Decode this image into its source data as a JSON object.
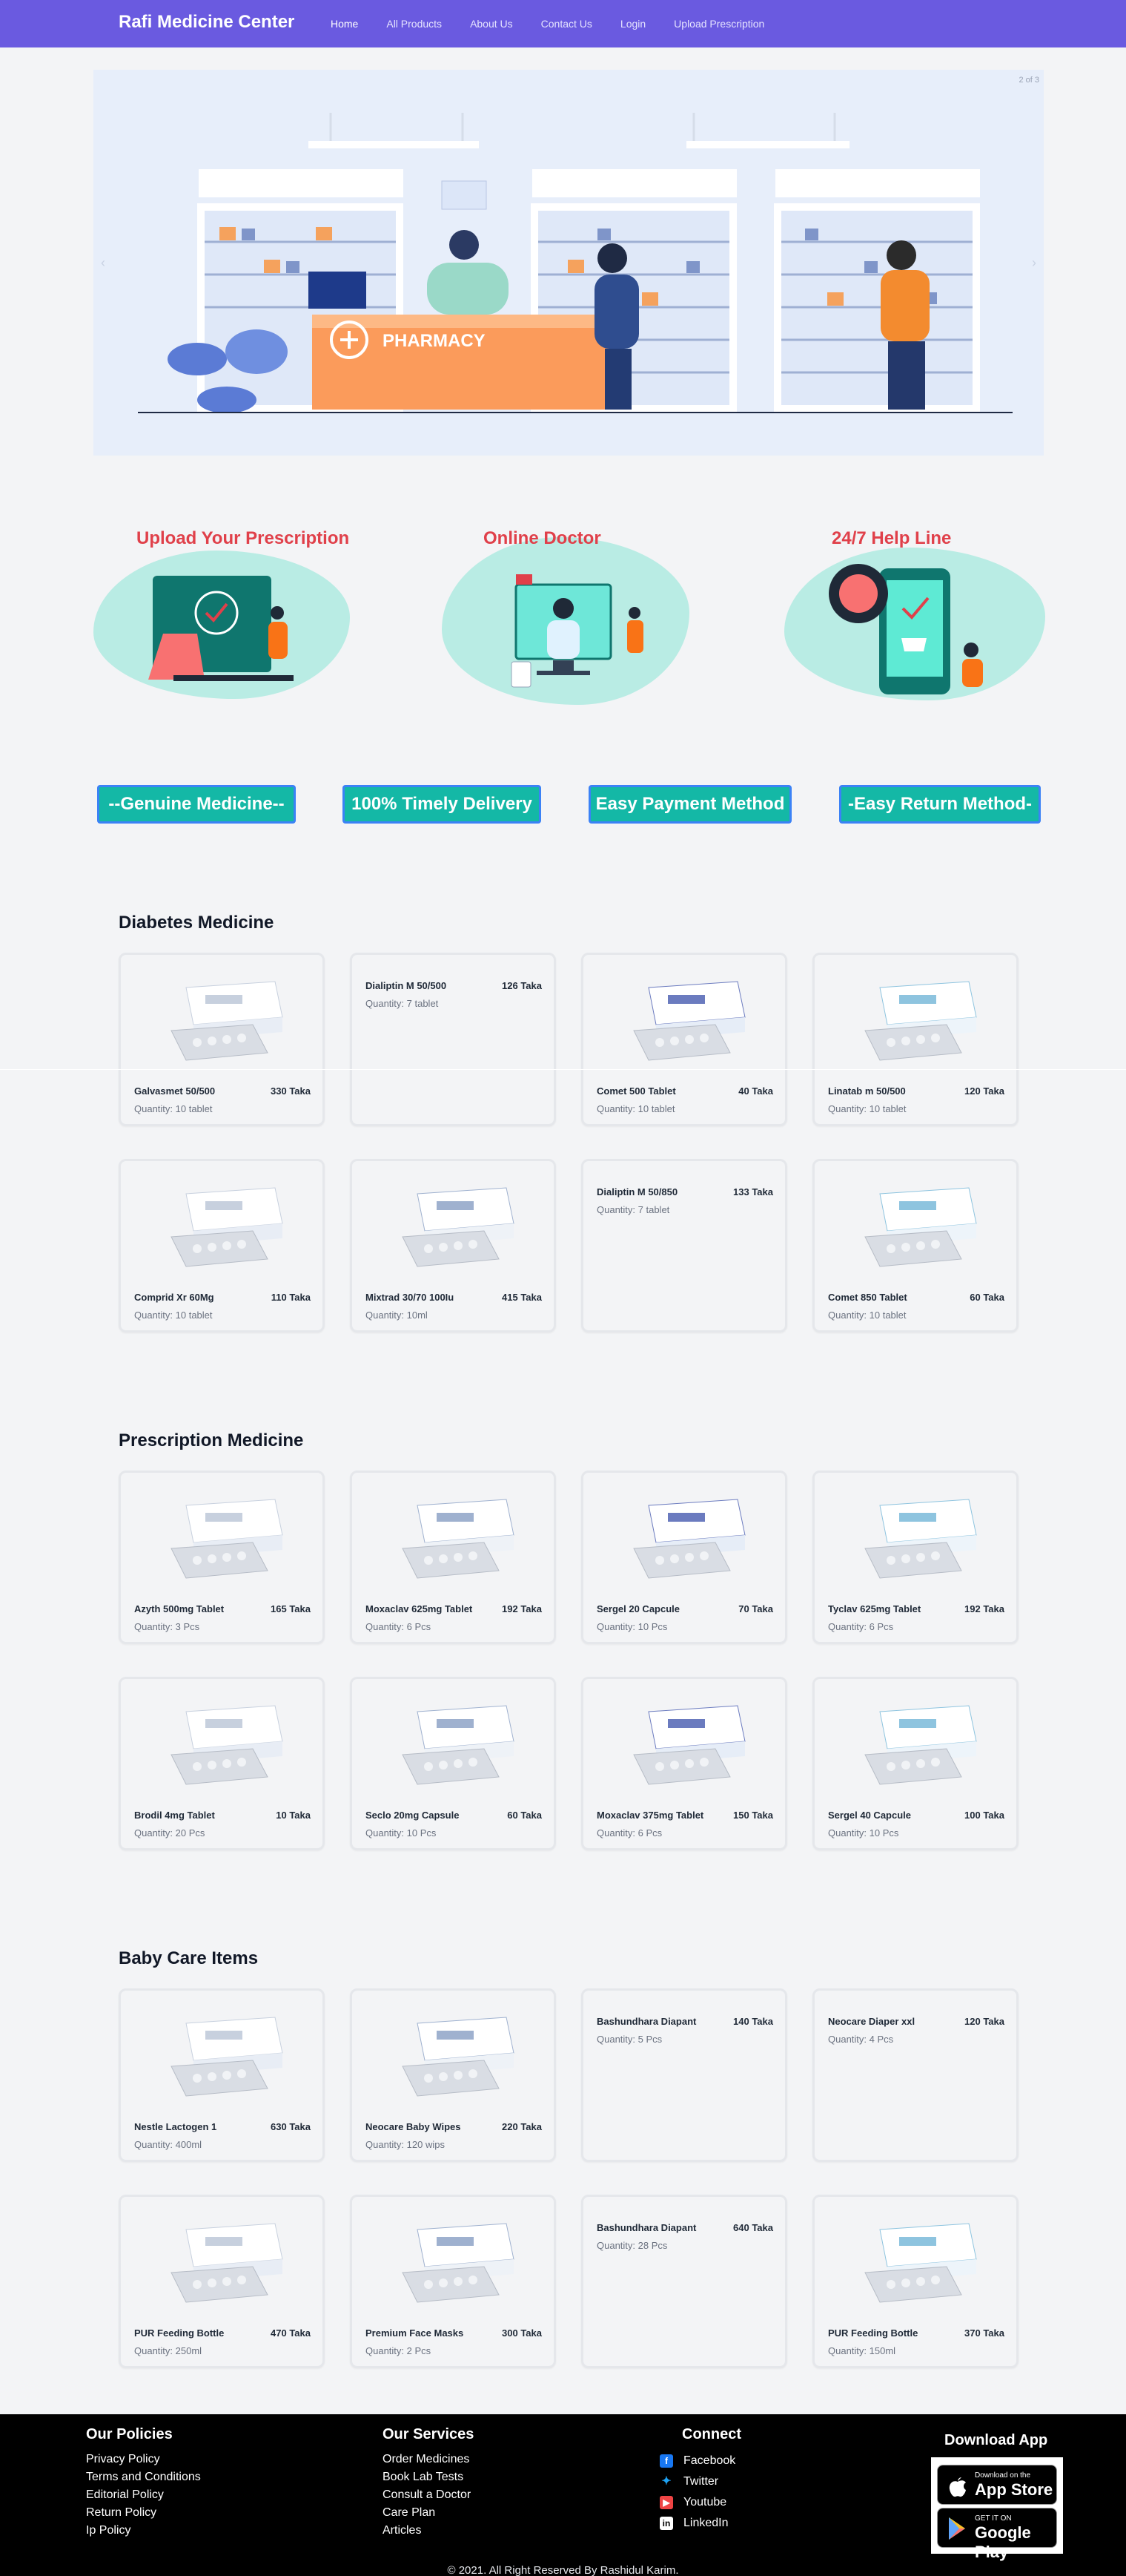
{
  "nav": {
    "brand": "Rafi Medicine Center",
    "links": [
      "Home",
      "All Products",
      "About Us",
      "Contact Us",
      "Login",
      "Upload Prescription"
    ]
  },
  "hero": {
    "counter": "2 of 3",
    "sign": "PHARMACY",
    "prev_icon": "chevron-left-icon",
    "next_icon": "chevron-right-icon"
  },
  "services": [
    {
      "title": "Upload Your Prescription",
      "icon": "prescription-upload-illustration"
    },
    {
      "title": "Online Doctor",
      "icon": "online-doctor-illustration"
    },
    {
      "title": "24/7 Help Line",
      "icon": "help-line-illustration"
    }
  ],
  "badges": [
    "--Genuine Medicine--",
    "100% Timely Delivery",
    "Easy Payment Method",
    "-Easy Return Method-"
  ],
  "sections": [
    {
      "title": "Diabetes Medicine",
      "products": [
        {
          "name": "Galvasmet 50/500",
          "price": "330 Taka",
          "qty": "Quantity: 10 tablet",
          "has_image": true
        },
        {
          "name": "Dialiptin M 50/500",
          "price": "126 Taka",
          "qty": "Quantity: 7 tablet",
          "has_image": false
        },
        {
          "name": "Comet 500 Tablet",
          "price": "40 Taka",
          "qty": "Quantity: 10 tablet",
          "has_image": true
        },
        {
          "name": "Linatab m 50/500",
          "price": "120 Taka",
          "qty": "Quantity: 10 tablet",
          "has_image": true
        },
        {
          "name": "Comprid Xr 60Mg",
          "price": "110 Taka",
          "qty": "Quantity: 10 tablet",
          "has_image": true
        },
        {
          "name": "Mixtrad 30/70 100Iu",
          "price": "415 Taka",
          "qty": "Quantity: 10ml",
          "has_image": true
        },
        {
          "name": "Dialiptin M 50/850",
          "price": "133 Taka",
          "qty": "Quantity: 7 tablet",
          "has_image": false
        },
        {
          "name": "Comet 850 Tablet",
          "price": "60 Taka",
          "qty": "Quantity: 10 tablet",
          "has_image": true
        }
      ]
    },
    {
      "title": "Prescription Medicine",
      "products": [
        {
          "name": "Azyth 500mg Tablet",
          "price": "165 Taka",
          "qty": "Quantity: 3 Pcs",
          "has_image": true
        },
        {
          "name": "Moxaclav 625mg Tablet",
          "price": "192 Taka",
          "qty": "Quantity: 6 Pcs",
          "has_image": true
        },
        {
          "name": "Sergel 20 Capcule",
          "price": "70 Taka",
          "qty": "Quantity: 10 Pcs",
          "has_image": true
        },
        {
          "name": "Tyclav 625mg Tablet",
          "price": "192 Taka",
          "qty": "Quantity: 6 Pcs",
          "has_image": true
        },
        {
          "name": "Brodil 4mg Tablet",
          "price": "10 Taka",
          "qty": "Quantity: 20 Pcs",
          "has_image": true
        },
        {
          "name": "Seclo 20mg Capsule",
          "price": "60 Taka",
          "qty": "Quantity: 10 Pcs",
          "has_image": true
        },
        {
          "name": "Moxaclav 375mg Tablet",
          "price": "150 Taka",
          "qty": "Quantity: 6 Pcs",
          "has_image": true
        },
        {
          "name": "Sergel 40 Capcule",
          "price": "100 Taka",
          "qty": "Quantity: 10 Pcs",
          "has_image": true
        }
      ]
    },
    {
      "title": "Baby Care Items",
      "products": [
        {
          "name": "Nestle Lactogen 1",
          "price": "630 Taka",
          "qty": "Quantity: 400ml",
          "has_image": true
        },
        {
          "name": "Neocare Baby Wipes",
          "price": "220 Taka",
          "qty": "Quantity: 120 wips",
          "has_image": true
        },
        {
          "name": "Bashundhara Diapant",
          "price": "140 Taka",
          "qty": "Quantity: 5 Pcs",
          "has_image": false
        },
        {
          "name": "Neocare Diaper xxl",
          "price": "120 Taka",
          "qty": "Quantity: 4 Pcs",
          "has_image": false
        },
        {
          "name": "PUR Feeding Bottle",
          "price": "470 Taka",
          "qty": "Quantity: 250ml",
          "has_image": true
        },
        {
          "name": "Premium Face Masks",
          "price": "300 Taka",
          "qty": "Quantity: 2 Pcs",
          "has_image": true
        },
        {
          "name": "Bashundhara Diapant",
          "price": "640 Taka",
          "qty": "Quantity: 28 Pcs",
          "has_image": false
        },
        {
          "name": "PUR Feeding Bottle",
          "price": "370 Taka",
          "qty": "Quantity: 150ml",
          "has_image": true
        }
      ]
    }
  ],
  "footer": {
    "policies": {
      "title": "Our Policies",
      "links": [
        "Privacy Policy",
        "Terms and Conditions",
        "Editorial Policy",
        "Return Policy",
        "Ip Policy"
      ]
    },
    "services": {
      "title": "Our Services",
      "links": [
        "Order Medicines",
        "Book Lab Tests",
        "Consult a Doctor",
        "Care Plan",
        "Articles"
      ]
    },
    "connect": {
      "title": "Connect",
      "links": [
        {
          "label": "Facebook",
          "icon": "facebook-icon",
          "color": "#1877f2"
        },
        {
          "label": "Twitter",
          "icon": "twitter-icon",
          "color": "#1da1f2"
        },
        {
          "label": "Youtube",
          "icon": "youtube-icon",
          "color": "#ef4444"
        },
        {
          "label": "LinkedIn",
          "icon": "linkedin-icon",
          "color": "#ffffff"
        }
      ]
    },
    "app": {
      "title": "Download App",
      "appstore_small": "Download on the",
      "appstore_big": "App Store",
      "play_small": "GET IT ON",
      "play_big": "Google Play"
    },
    "copyright": "© 2021. All Right Reserved By Rashidul Karim."
  },
  "colors": {
    "nav": "#6a5ae0",
    "accent_red": "#e0404a",
    "badge": "#14b8a6",
    "badge_border": "#3b82f6"
  }
}
